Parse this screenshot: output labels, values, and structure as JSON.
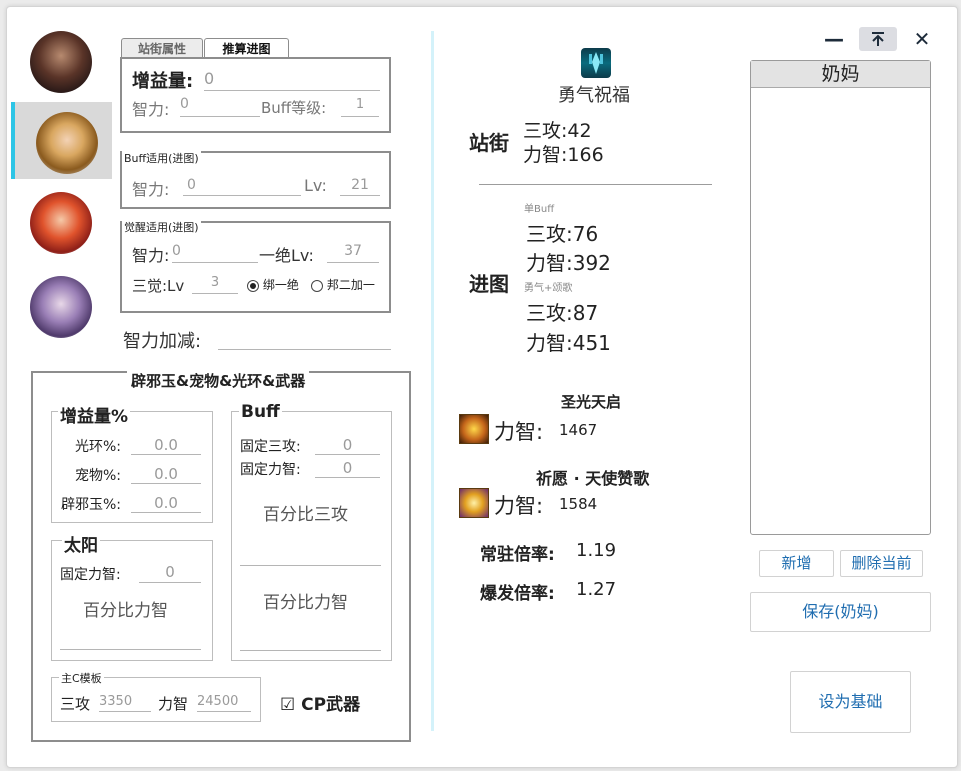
{
  "window": {
    "minimize_glyph": "—",
    "pin_glyph": "⊼",
    "close_glyph": "✕"
  },
  "characters": [
    {
      "icon": "dark-haired-male-portrait",
      "selected": false
    },
    {
      "icon": "gold-crowned-female-portrait",
      "selected": true
    },
    {
      "icon": "red-haired-female-portrait",
      "selected": false
    },
    {
      "icon": "silver-haired-mage-portrait",
      "selected": false
    }
  ],
  "tabs": {
    "street": "站街属性",
    "dungeon": "推算进图"
  },
  "gain": {
    "label": "增益量:",
    "value": "0"
  },
  "int_row": {
    "int_label": "智力:",
    "int_value": "0",
    "buff_label": "Buff等级:",
    "buff_value": "1"
  },
  "buff_dungeon": {
    "legend": "Buff适用(进图)",
    "int_label": "智力:",
    "int_value": "0",
    "lv_label": "Lv:",
    "lv_value": "21"
  },
  "awaken_dungeon": {
    "legend": "觉醒适用(进图)",
    "int_label": "智力:",
    "int_value": "0",
    "lv1_label": "一绝Lv:",
    "lv1_value": "37",
    "lv3_label": "三觉:Lv",
    "lv3_value": "3",
    "opt1": "绑一绝",
    "opt2": "邦二加一"
  },
  "int_adjust": {
    "label": "智力加减:",
    "value": ""
  },
  "equip": {
    "title": "辟邪玉&宠物&光环&武器",
    "gain_pct": {
      "legend": "增益量%",
      "aura_label": "光环%:",
      "aura_value": "0.0",
      "pet_label": "宠物%:",
      "pet_value": "0.0",
      "jade_label": "辟邪玉%:",
      "jade_value": "0.0"
    },
    "sun": {
      "legend": "太阳",
      "fixed_int_label": "固定力智:",
      "fixed_int_value": "0",
      "pct_int": "百分比力智"
    },
    "buff": {
      "legend": "Buff",
      "fixed_atk_label": "固定三攻:",
      "fixed_atk_value": "0",
      "fixed_int_label": "固定力智:",
      "fixed_int_value": "0",
      "pct_atk": "百分比三攻",
      "pct_int": "百分比力智"
    },
    "main_c": {
      "legend": "主C模板",
      "atk_label": "三攻",
      "atk_value": "3350",
      "int_label": "力智",
      "int_value": "24500"
    },
    "cp_weapon": {
      "check": "☑",
      "label": "CP武器"
    }
  },
  "result": {
    "skill_name": "勇气祝福",
    "street": {
      "label": "站街",
      "atk": "三攻:42",
      "int": "力智:166"
    },
    "dungeon": {
      "label": "进图",
      "single_buff": "单Buff",
      "atk1": "三攻:76",
      "int1": "力智:392",
      "combo": "勇气+颂歌",
      "atk2": "三攻:87",
      "int2": "力智:451"
    },
    "skill2": {
      "name": "圣光天启",
      "label": "力智:",
      "value": "1467"
    },
    "skill3": {
      "name": "祈愿 · 天使赞歌",
      "label": "力智:",
      "value": "1584"
    },
    "normal_rate": {
      "label": "常驻倍率:",
      "value": "1.19"
    },
    "burst_rate": {
      "label": "爆发倍率:",
      "value": "1.27"
    }
  },
  "profiles": {
    "header": "奶妈",
    "items": []
  },
  "buttons": {
    "add": "新增",
    "delete": "删除当前",
    "save": "保存(奶妈)",
    "set_base": "设为基础"
  },
  "colors": {
    "accent": "#2dc5e6",
    "button_text": "#1f6db0"
  }
}
